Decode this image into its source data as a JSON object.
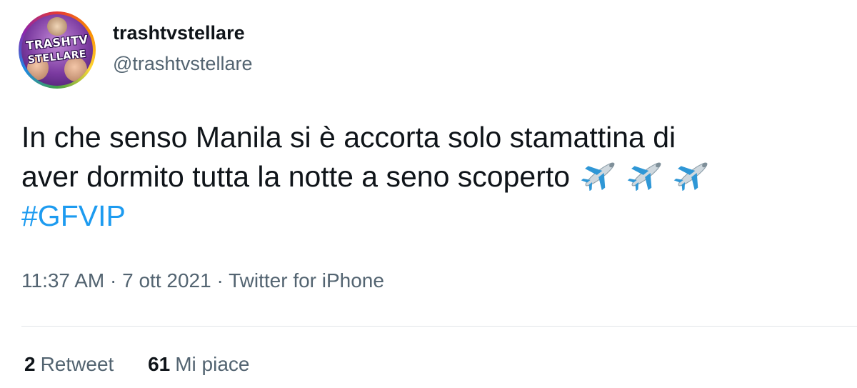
{
  "user": {
    "display_name": "trashtvstellare",
    "handle": "@trashtvstellare",
    "avatar_text_line1": "TRASHTV",
    "avatar_text_line2": "STELLARE"
  },
  "tweet": {
    "text_line1": "In che senso Manila si è accorta solo stamattina di",
    "text_line2": "aver dormito tutta la notte a seno scoperto",
    "emojis": [
      "airplane-icon",
      "airplane-icon",
      "airplane-icon"
    ],
    "hashtag": "#GFVIP"
  },
  "meta": {
    "time": "11:37 AM",
    "separator1": " · ",
    "date": "7 ott 2021",
    "separator2": " · ",
    "source": "Twitter for iPhone"
  },
  "stats": {
    "retweets_count": "2",
    "retweets_label": "Retweet",
    "likes_count": "61",
    "likes_label": "Mi piace"
  },
  "colors": {
    "text": "#0f1419",
    "secondary": "#536471",
    "link": "#1d9bf0",
    "divider": "#e1e5e8"
  }
}
